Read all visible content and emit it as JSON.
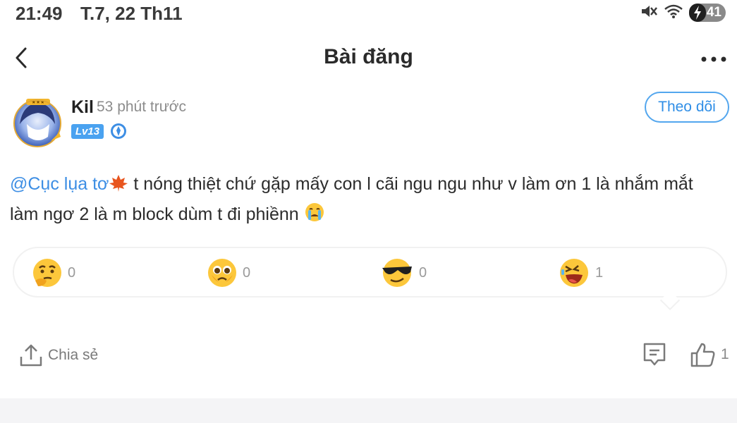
{
  "status_bar": {
    "time": "21:49",
    "date": "T.7, 22 Th11",
    "battery": "41",
    "icons": [
      "mute-icon",
      "wifi-icon",
      "battery-icon"
    ]
  },
  "header": {
    "title": "Bài đăng",
    "back_icon": "chevron-left-icon",
    "more_icon": "more-dots-icon"
  },
  "author": {
    "name": "Kil",
    "time_ago": "53 phút trước",
    "level": "Lv13",
    "follow_label": "Theo dõi"
  },
  "post": {
    "mention": "@Cục lụa tơ",
    "text": " t nóng thiệt chứ gặp mấy con l cãi ngu ngu như v làm ơn 1 là nhắm mắt làm ngơ 2 là m block dùm t đi phiềnn",
    "mention_emoji": "maple-leaf-emoji",
    "trailing_emoji": "crying-face-emoji"
  },
  "reactions": [
    {
      "icon": "thinking-emoji",
      "count": "0"
    },
    {
      "icon": "teary-eyed-emoji",
      "count": "0"
    },
    {
      "icon": "sunglasses-emoji",
      "count": "0"
    },
    {
      "icon": "laughing-emoji",
      "count": "1"
    }
  ],
  "actions": {
    "share_label": "Chia sẻ",
    "like_count": "1"
  },
  "colors": {
    "accent": "#3d8ee4",
    "follow_border": "#53a6ee",
    "level_badge": "#4aa2f0",
    "muted_text": "#8c8c8c"
  }
}
